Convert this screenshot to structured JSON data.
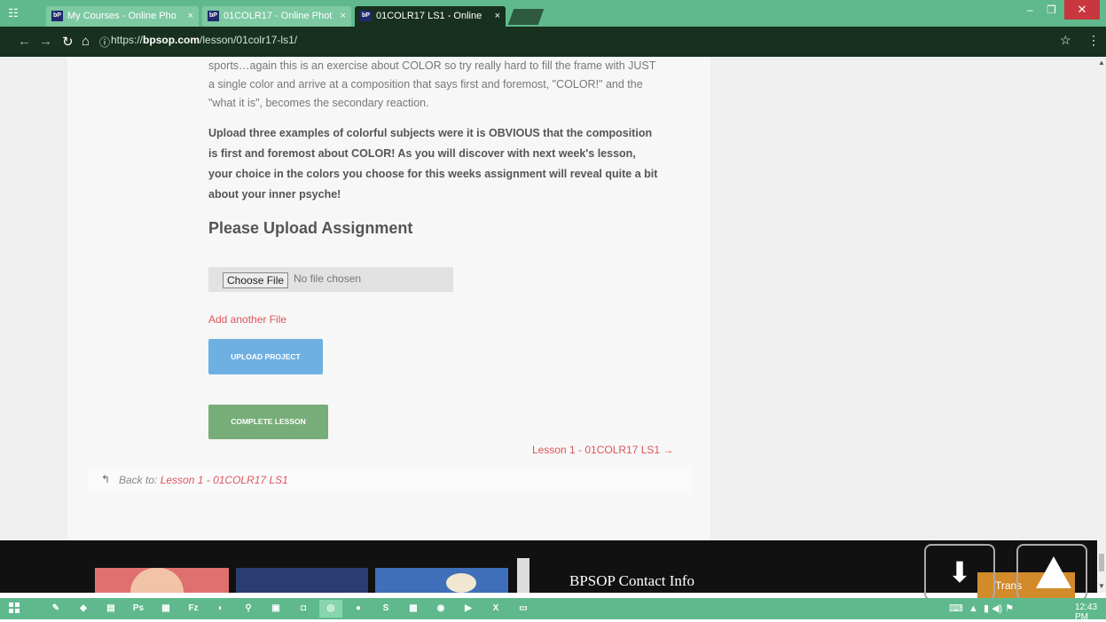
{
  "browser": {
    "tabs": [
      {
        "label": "My Courses - Online Pho",
        "favicon": "bP"
      },
      {
        "label": "01COLR17 - Online Phot",
        "favicon": "bP"
      },
      {
        "label": "01COLR17 LS1 - Online",
        "favicon": "bP"
      }
    ],
    "url_prefix": "https://",
    "url_host": "bpsop.com",
    "url_path": "/lesson/01colr17-ls1/",
    "accent_color": "#5fb98d"
  },
  "lesson": {
    "intro_lines": [
      "sports…again this is an exercise about COLOR so try really hard to fill the frame with JUST",
      "a single color and arrive at a composition that says first and foremost, \"COLOR!\" and the",
      "\"what it is\", becomes the secondary reaction."
    ],
    "instruction_lines": [
      "Upload three examples of colorful subjects were it is OBVIOUS that the composition",
      "is first and foremost about COLOR! As you will discover with next week's lesson,",
      "your choice in the colors you choose for this weeks assignment will reveal quite a bit",
      "about your inner psyche!"
    ],
    "upload_heading": "Please Upload Assignment",
    "choose_file_label": "Choose File",
    "no_file_text": "No file chosen",
    "add_file_link": "Add another File",
    "upload_button": "UPLOAD PROJECT",
    "complete_button": "COMPLETE LESSON",
    "next_lesson_link": "Lesson 1 - 01COLR17 LS1 →",
    "back_prefix": "Back to:",
    "back_link": "Lesson 1 - 01COLR17 LS1"
  },
  "footer": {
    "contact_heading": "BPSOP Contact Info",
    "translate_label": "Trans"
  },
  "taskbar": {
    "time": "12:43 PM"
  }
}
